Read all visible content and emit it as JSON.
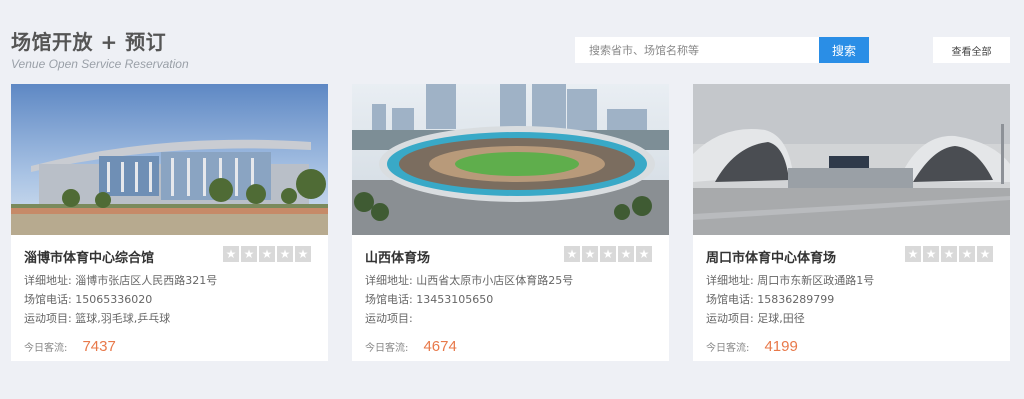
{
  "header": {
    "title": "场馆开放 + 预订",
    "subtitle": "Venue Open Service Reservation"
  },
  "search": {
    "placeholder": "搜索省市、场馆名称等",
    "button_label": "搜索"
  },
  "view_all_label": "查看全部",
  "labels": {
    "address": "详细地址:",
    "phone": "场馆电话:",
    "sports": "运动项目:",
    "traffic": "今日客流:"
  },
  "venues": [
    {
      "name": "淄博市体育中心综合馆",
      "address": "淄博市张店区人民西路321号",
      "phone": "15065336020",
      "sports": "篮球,羽毛球,乒乓球",
      "traffic": "7437",
      "rating": 0
    },
    {
      "name": "山西体育场",
      "address": "山西省太原市小店区体育路25号",
      "phone": "13453105650",
      "sports": "",
      "traffic": "4674",
      "rating": 0
    },
    {
      "name": "周口市体育中心体育场",
      "address": "周口市东新区政通路1号",
      "phone": "15836289799",
      "sports": "足球,田径",
      "traffic": "4199",
      "rating": 0
    }
  ],
  "colors": {
    "page_background": "#eef0f5",
    "accent_blue": "#2a8ee6",
    "traffic_orange": "#e8794a",
    "star_inactive": "#d9d9d9"
  }
}
